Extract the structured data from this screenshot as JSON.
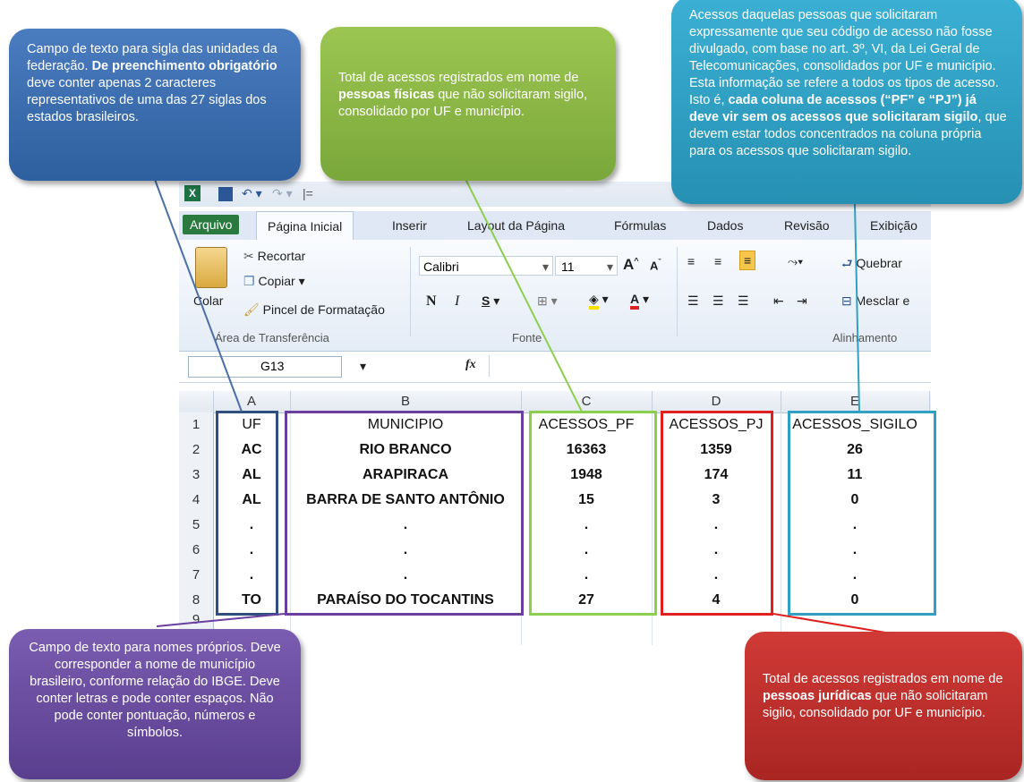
{
  "window": {
    "title_bar_sep": "|="
  },
  "tabs": [
    "Arquivo",
    "Página Inicial",
    "Inserir",
    "Layout da Página",
    "Fórmulas",
    "Dados",
    "Revisão",
    "Exibição"
  ],
  "ribbon": {
    "paste": "Colar",
    "cut": "Recortar",
    "copy": "Copiar",
    "format_painter": "Pincel de Formatação",
    "clipboard_group": "Área de Transferência",
    "font_name": "Calibri",
    "font_size": "11",
    "bold": "N",
    "italic": "I",
    "underline": "S",
    "font_group": "Fonte",
    "wrap": "Quebrar",
    "merge": "Mesclar e",
    "align_group": "Alinhamento"
  },
  "formula_bar": {
    "name_box": "G13",
    "fx": "fx"
  },
  "columns": [
    "A",
    "B",
    "C",
    "D",
    "E"
  ],
  "row_numbers": [
    "1",
    "2",
    "3",
    "4",
    "5",
    "6",
    "7",
    "8",
    "9"
  ],
  "rows": [
    [
      "UF",
      "MUNICIPIO",
      "ACESSOS_PF",
      "ACESSOS_PJ",
      "ACESSOS_SIGILO"
    ],
    [
      "AC",
      "RIO BRANCO",
      "16363",
      "1359",
      "26"
    ],
    [
      "AL",
      "ARAPIRACA",
      "1948",
      "174",
      "11"
    ],
    [
      "AL",
      "BARRA DE SANTO ANTÔNIO",
      "15",
      "3",
      "0"
    ],
    [
      ".",
      ".",
      ".",
      ".",
      "."
    ],
    [
      ".",
      ".",
      ".",
      ".",
      "."
    ],
    [
      ".",
      ".",
      ".",
      ".",
      "."
    ],
    [
      "TO",
      "PARAÍSO DO TOCANTINS",
      "27",
      "4",
      "0"
    ]
  ],
  "notes": {
    "uf": {
      "pre": "Campo de texto para sigla das unidades da federação. ",
      "bold": "De preenchimento obrigatório",
      "post": " deve conter apenas 2 caracteres representativos de uma das 27 siglas dos estados brasileiros.",
      "color": "#3e6fb0"
    },
    "pf": {
      "pre": "Total de acessos registrados em nome de ",
      "bold": "pessoas físicas",
      "post": " que não solicitaram sigilo, consolidado por UF e município.",
      "color": "#8cb443"
    },
    "sigilo": {
      "pre": "Acessos daquelas pessoas que solicitaram expressamente que seu código de acesso não fosse divulgado, com base no art. 3º, VI, da Lei Geral de Telecomunicações, consolidados por UF e município. Esta informação se refere a todos os tipos de acesso. Isto é, ",
      "bold": "cada coluna de acessos (“PF” e “PJ”) já deve vir sem os acessos que solicitaram sigilo",
      "post": ", que devem estar todos concentrados na coluna própria para os acessos que solicitaram sigilo.",
      "color": "#31a0c3"
    },
    "municipio": {
      "text": "Campo de texto para nomes próprios. Deve corresponder a nome de município brasileiro, conforme relação do IBGE. Deve conter letras e pode conter espaços. Não pode conter pontuação, números e símbolos.",
      "color": "#6b4ea0"
    },
    "pj": {
      "pre": "Total de acessos registrados em nome de ",
      "bold": "pessoas jurídicas",
      "post": " que não solicitaram sigilo, consolidado por UF e município.",
      "color": "#c0312f"
    }
  }
}
